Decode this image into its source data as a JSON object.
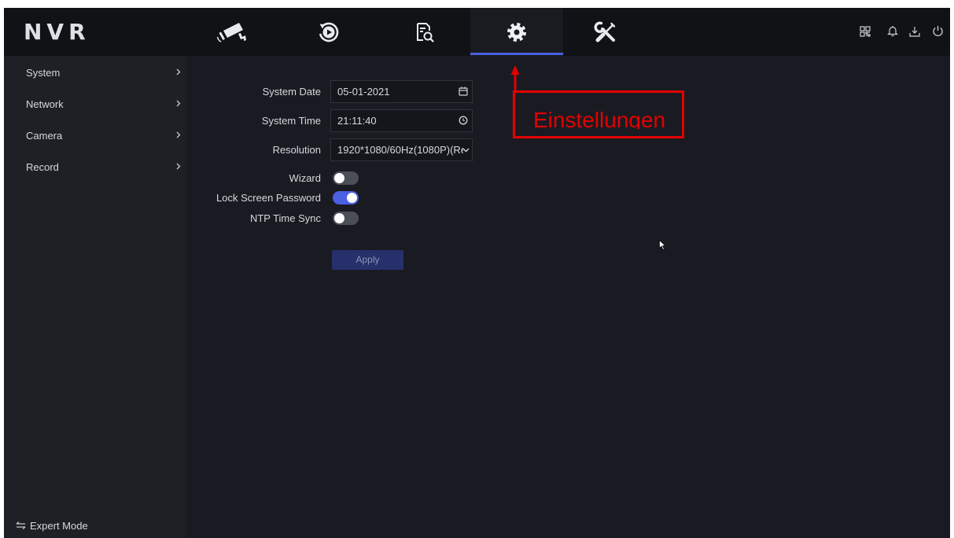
{
  "app": {
    "logo": "NVR"
  },
  "colors": {
    "accent": "#4b5fe3",
    "annotation": "#e30000",
    "topbar": "#111216",
    "background": "#1a1b22",
    "sidebar": "#1f2026"
  },
  "top_nav": {
    "tabs": [
      {
        "icon": "camera-icon",
        "active": false
      },
      {
        "icon": "playback-icon",
        "active": false
      },
      {
        "icon": "file-search-icon",
        "active": false
      },
      {
        "icon": "gear-icon",
        "active": true
      },
      {
        "icon": "tools-icon",
        "active": false
      }
    ],
    "actions": [
      {
        "icon": "qr-code-icon"
      },
      {
        "icon": "bell-icon"
      },
      {
        "icon": "download-icon"
      },
      {
        "icon": "power-icon"
      }
    ]
  },
  "sidebar": {
    "items": [
      {
        "label": "System",
        "icon": "chevron-right-icon"
      },
      {
        "label": "Network",
        "icon": "chevron-right-icon"
      },
      {
        "label": "Camera",
        "icon": "chevron-right-icon"
      },
      {
        "label": "Record",
        "icon": "chevron-right-icon"
      }
    ],
    "expert_mode": {
      "icon": "swap-icon",
      "label": "Expert Mode"
    }
  },
  "form": {
    "system_date": {
      "label": "System Date",
      "value": "05-01-2021",
      "icon": "calendar-icon"
    },
    "system_time": {
      "label": "System Time",
      "value": "21:11:40",
      "icon": "clock-icon"
    },
    "resolution": {
      "label": "Resolution",
      "value": "1920*1080/60Hz(1080P)(Re",
      "icon": "chevron-down-icon"
    },
    "wizard": {
      "label": "Wizard",
      "enabled": false
    },
    "lock_screen_password": {
      "label": "Lock Screen Password",
      "enabled": true
    },
    "ntp_time_sync": {
      "label": "NTP Time Sync",
      "enabled": false
    },
    "apply_label": "Apply"
  },
  "annotation": {
    "text": "Einstellungen",
    "icon": "arrow-up-icon"
  },
  "cursor": {
    "icon": "mouse-cursor-icon"
  }
}
